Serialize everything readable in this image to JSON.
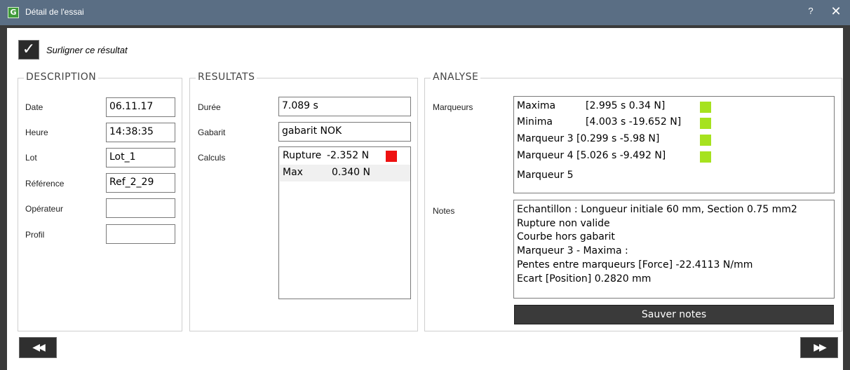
{
  "window": {
    "title": "Détail de l'essai",
    "app_icon_glyph": "G",
    "help_label": "?",
    "close_label": "✕"
  },
  "highlight": {
    "checked": true,
    "check_glyph": "✓",
    "label": "Surligner ce résultat"
  },
  "description": {
    "title": "DESCRIPTION",
    "fields": [
      {
        "label": "Date",
        "value": "06.11.17"
      },
      {
        "label": "Heure",
        "value": "14:38:35"
      },
      {
        "label": "Lot",
        "value": "Lot_1"
      },
      {
        "label": "Référence",
        "value": "Ref_2_29"
      },
      {
        "label": "Opérateur",
        "value": ""
      },
      {
        "label": "Profil",
        "value": ""
      }
    ]
  },
  "results": {
    "title": "RESULTATS",
    "duration_label": "Durée",
    "duration_value": "7.089 s",
    "template_label": "Gabarit",
    "template_value": "gabarit NOK",
    "calcs_label": "Calculs",
    "calcs": [
      {
        "name": "Rupture",
        "value": "-2.352 N",
        "color": "#ee1111"
      },
      {
        "name": "Max",
        "value": "0.340 N",
        "color": ""
      }
    ]
  },
  "analysis": {
    "title": "ANALYSE",
    "markers_label": "Marqueurs",
    "markers": [
      {
        "name": "Maxima",
        "value": "[2.995 s 0.34 N]",
        "color": "#a6e21e"
      },
      {
        "name": "Minima",
        "value": "[4.003 s -19.652 N]",
        "color": "#a6e21e"
      },
      {
        "name": "Marqueur 3",
        "value": "[0.299 s -5.98 N]",
        "color": "#a6e21e"
      },
      {
        "name": "Marqueur 4",
        "value": "[5.026 s -9.492 N]",
        "color": "#a6e21e"
      },
      {
        "name": "Marqueur 5",
        "value": "",
        "color": ""
      }
    ],
    "notes_label": "Notes",
    "notes": [
      "Echantillon : Longueur initiale 60 mm, Section 0.75 mm2",
      "Rupture non valide",
      "Courbe hors gabarit",
      "Marqueur 3 - Maxima :",
      "Pentes entre marqueurs [Force] -22.4113 N/mm",
      "Ecart [Position] 0.2820 mm"
    ],
    "save_button": "Sauver notes"
  },
  "nav": {
    "prev_glyph": "◀◀",
    "next_glyph": "▶▶"
  }
}
